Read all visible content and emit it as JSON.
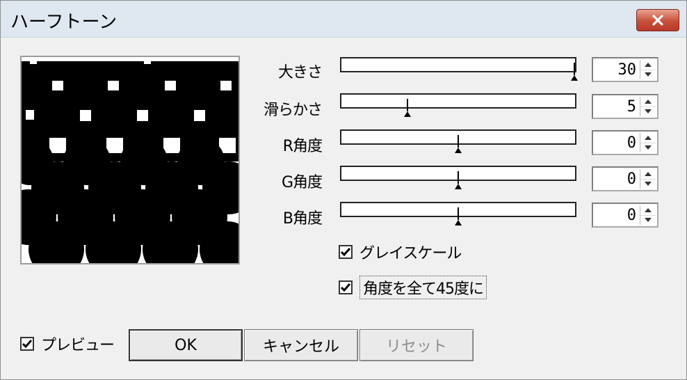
{
  "window": {
    "title": "ハーフトーン"
  },
  "colors": {
    "close_button": "#c8503a",
    "titlebar": "#dfe7f0"
  },
  "sliders": [
    {
      "key": "size",
      "label": "大きさ",
      "value": "30",
      "position": 1.0
    },
    {
      "key": "smoothness",
      "label": "滑らかさ",
      "value": "5",
      "position": 0.28
    },
    {
      "key": "r_angle",
      "label": "R角度",
      "value": "0",
      "position": 0.5
    },
    {
      "key": "g_angle",
      "label": "G角度",
      "value": "0",
      "position": 0.5
    },
    {
      "key": "b_angle",
      "label": "B角度",
      "value": "0",
      "position": 0.5
    }
  ],
  "options": {
    "grayscale": {
      "label": "グレイスケール",
      "checked": true
    },
    "all_45": {
      "label": "角度を全て45度に",
      "checked": true
    },
    "preview": {
      "label": "プレビュー",
      "checked": true
    }
  },
  "buttons": {
    "ok": "OK",
    "cancel": "キャンセル",
    "reset": "リセット"
  },
  "icons": {
    "close": "close-icon",
    "up": "up-arrow-icon",
    "down": "down-arrow-icon",
    "check": "check-icon"
  }
}
